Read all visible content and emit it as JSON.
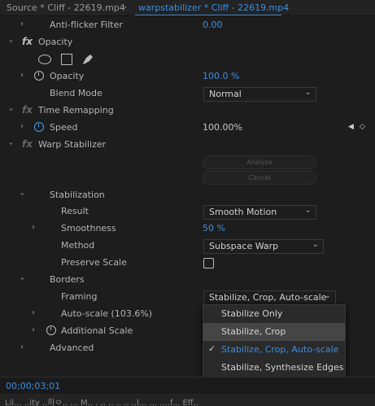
{
  "tabs": [
    {
      "label": "Source * Cliff - 22619.mp4"
    },
    {
      "label": "warpstabilizer * Cliff - 22619.mp4"
    }
  ],
  "rows": {
    "anti_flicker": {
      "label": "Anti-flicker Filter",
      "value": "0.00"
    },
    "opacity_section": {
      "fx": "fx",
      "label": "Opacity"
    },
    "opacity": {
      "label": "Opacity",
      "value": "100.0 %"
    },
    "blend_mode": {
      "label": "Blend Mode",
      "value": "Normal"
    },
    "time_remap": {
      "fx": "fx",
      "label": "Time Remapping"
    },
    "speed": {
      "label": "Speed",
      "value": "100.00%"
    },
    "warp": {
      "fx": "fx",
      "label": "Warp Stabilizer"
    },
    "analyze": {
      "label": "Analyze"
    },
    "cancel": {
      "label": "Cancel"
    },
    "stabilization": {
      "label": "Stabilization"
    },
    "result": {
      "label": "Result",
      "value": "Smooth Motion"
    },
    "smoothness": {
      "label": "Smoothness",
      "value": "50 %"
    },
    "method": {
      "label": "Method",
      "value": "Subspace Warp"
    },
    "preserve_scale": {
      "label": "Preserve Scale"
    },
    "borders": {
      "label": "Borders"
    },
    "framing": {
      "label": "Framing",
      "value": "Stabilize, Crop, Auto-scale"
    },
    "auto_scale": {
      "label": "Auto-scale (103.6%)"
    },
    "additional_scale": {
      "label": "Additional Scale"
    },
    "advanced": {
      "label": "Advanced"
    }
  },
  "framing_menu": {
    "options": [
      {
        "label": "Stabilize Only"
      },
      {
        "label": "Stabilize, Crop"
      },
      {
        "label": "Stabilize, Crop, Auto-scale"
      },
      {
        "label": "Stabilize, Synthesize Edges"
      }
    ],
    "highlighted": "Stabilize, Crop",
    "selected": "Stabilize, Crop, Auto-scale"
  },
  "timecode": "00;00;03;01",
  "bottom_bar_text": "Lil... ..ity ..하ㅇ.. ... M.. . .. .. .. .. ..l... ... ....f... Eff..",
  "colors": {
    "accent": "#3e8ede",
    "background": "#1d1d1d"
  }
}
